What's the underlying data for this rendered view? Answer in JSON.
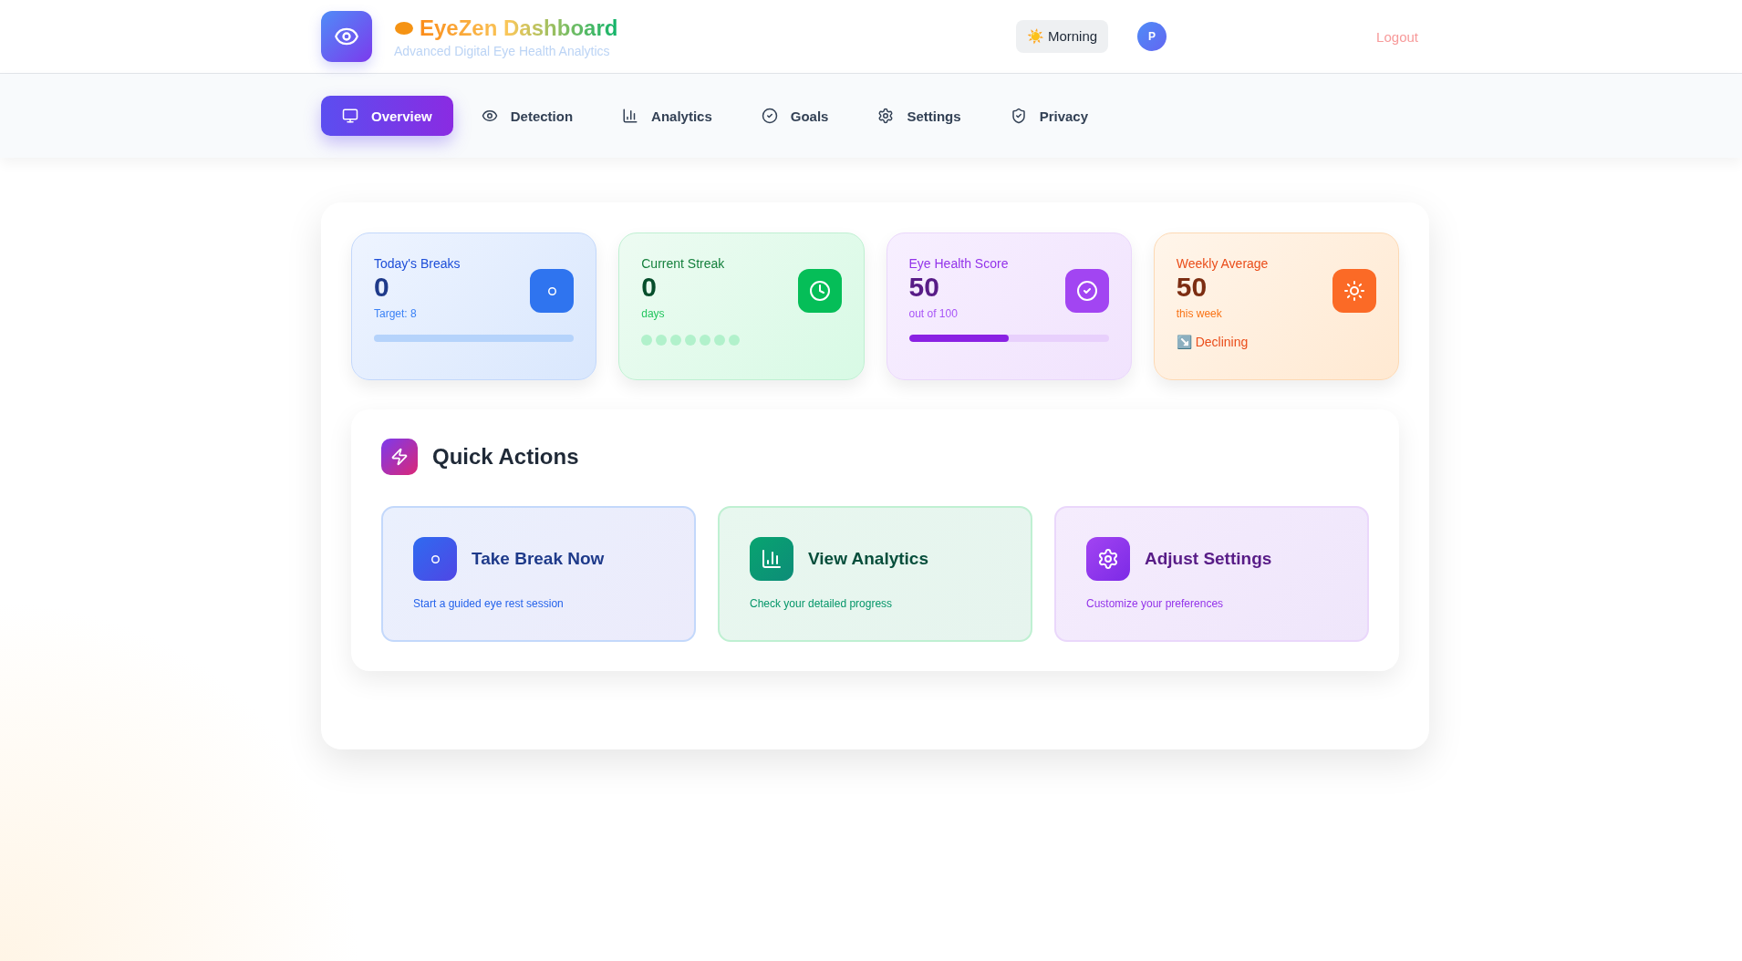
{
  "header": {
    "title": "EyeZen Dashboard",
    "subtitle": "Advanced Digital Eye Health Analytics",
    "greeting": {
      "emoji": "☀️",
      "label": "Morning"
    },
    "avatar": "P",
    "logout": "Logout"
  },
  "tabs": [
    {
      "label": "Overview",
      "selected": true
    },
    {
      "label": "Detection",
      "selected": false
    },
    {
      "label": "Analytics",
      "selected": false
    },
    {
      "label": "Goals",
      "selected": false
    },
    {
      "label": "Settings",
      "selected": false
    },
    {
      "label": "Privacy",
      "selected": false
    }
  ],
  "stats": [
    {
      "kind": "progress",
      "title": "Today's Breaks",
      "value": "0",
      "caption": "Target: 8",
      "level": 0
    },
    {
      "kind": "dots",
      "title": "Current Streak",
      "value": "0",
      "caption": "days",
      "dots": [
        {
          "filled": false
        },
        {
          "filled": false
        },
        {
          "filled": false
        },
        {
          "filled": false
        },
        {
          "filled": false
        },
        {
          "filled": false
        },
        {
          "filled": false
        }
      ]
    },
    {
      "kind": "progress",
      "title": "Eye Health Score",
      "value": "50",
      "caption": "out of 100",
      "level": 0.5
    },
    {
      "kind": "trend",
      "title": "Weekly Average",
      "value": "50",
      "caption": "this week",
      "trend": {
        "emoji": "↘️",
        "label": "Declining"
      }
    }
  ],
  "quick_actions": {
    "title": "Quick Actions",
    "actions": [
      {
        "title": "Take Break Now",
        "description": "Start a guided eye rest session"
      },
      {
        "title": "View Analytics",
        "description": "Check your detailed progress"
      },
      {
        "title": "Adjust Settings",
        "description": "Customize your preferences"
      }
    ]
  }
}
